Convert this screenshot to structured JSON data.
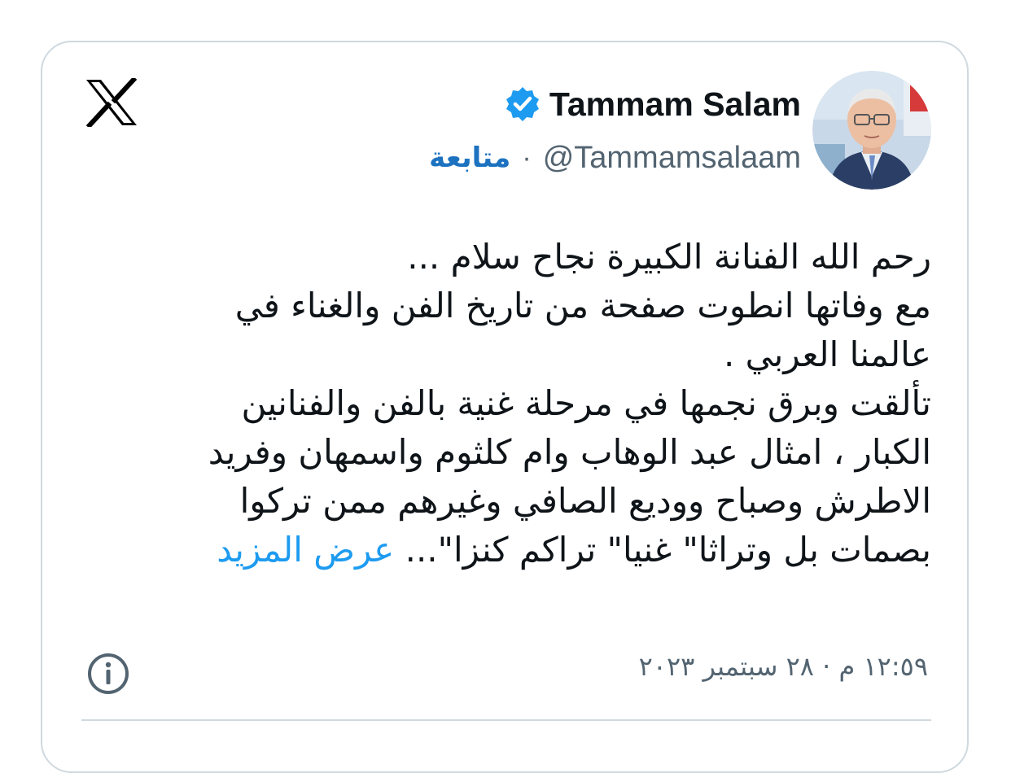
{
  "author": {
    "display_name": "Tammam Salam",
    "handle": "@Tammamsalaam",
    "separator": "·",
    "follow_label": "متابعة",
    "verified": true,
    "avatar": "profile-photo"
  },
  "tweet": {
    "lines": [
      "رحم الله الفنانة الكبيرة نجاح سلام ...",
      "مع وفاتها انطوت صفحة من تاريخ الفن والغناء في",
      "عالمنا العربي .",
      "تألقت وبرق نجمها في مرحلة غنية بالفن والفنانين",
      "الكبار ، امثال عبد الوهاب وام كلثوم واسمهان وفريد",
      "الاطرش وصباح ووديع الصافي وغيرهم ممن تركوا",
      "بصمات بل وتراثا\" غنيا\" تراكم كنزا\"..."
    ],
    "show_more_label": "عرض المزيد",
    "timestamp": "١٢:٥٩ م · ٢٨ سبتمبر ٢٠٢٣"
  },
  "icons": {
    "platform_logo": "x-logo-icon",
    "verified_badge": "verified-badge-icon",
    "info": "info-icon"
  },
  "colors": {
    "text": "#0f1419",
    "secondary": "#536471",
    "link": "#1d9bf0",
    "follow": "#1d72c0",
    "border": "#cfd9de"
  }
}
